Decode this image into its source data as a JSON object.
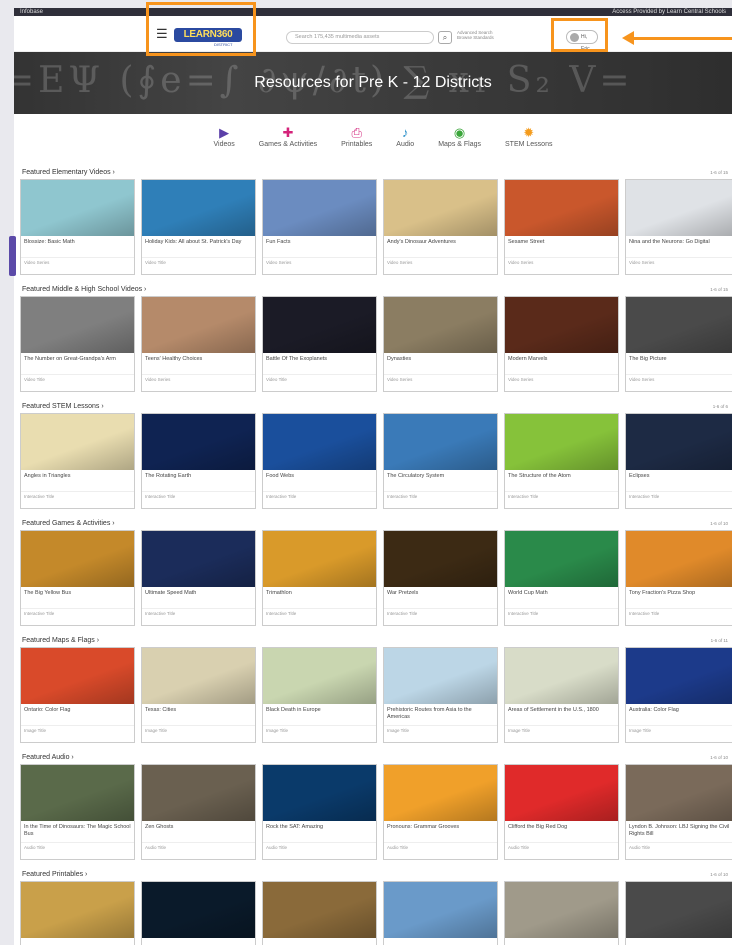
{
  "topbar": {
    "brand": "Infobase",
    "notice": "Access Provided by Learn Central Schools"
  },
  "header": {
    "logo_text": "LEARN360",
    "logo_sub": "DISTRICT",
    "search_placeholder": "Search 175,435 multimedia assets",
    "advanced_search": "Advanced Search",
    "browse_standards": "Browse Standards",
    "user_label": "Hi, Eric"
  },
  "hero": {
    "title": "Resources for Pre K - 12 Districts"
  },
  "categories": [
    {
      "label": "Videos",
      "icon": "play-icon",
      "color": "#5b3fa8"
    },
    {
      "label": "Games & Activities",
      "icon": "puzzle-icon",
      "color": "#d4237a"
    },
    {
      "label": "Printables",
      "icon": "printer-icon",
      "color": "#d63384"
    },
    {
      "label": "Audio",
      "icon": "speaker-icon",
      "color": "#2a8fc9"
    },
    {
      "label": "Maps & Flags",
      "icon": "globe-icon",
      "color": "#3aa63a"
    },
    {
      "label": "STEM Lessons",
      "icon": "gear-icon",
      "color": "#f49b1c"
    }
  ],
  "sections": [
    {
      "title": "Featured Elementary Videos ›",
      "count": "1-6 of 15",
      "cards": [
        {
          "title": "Blossize: Basic Math",
          "sub": "Video Series"
        },
        {
          "title": "Holiday Kids: All about St. Patrick's Day",
          "sub": "Video Title"
        },
        {
          "title": "Fun Facts",
          "sub": "Video Series"
        },
        {
          "title": "Andy's Dinosaur Adventures",
          "sub": "Video Series"
        },
        {
          "title": "Sesame Street",
          "sub": "Video Series"
        },
        {
          "title": "Nina and the Neurons: Go Digital",
          "sub": "Video Series"
        }
      ]
    },
    {
      "title": "Featured Middle & High School Videos ›",
      "count": "1-6 of 15",
      "cards": [
        {
          "title": "The Number on Great-Grandpa's Arm",
          "sub": "Video Title"
        },
        {
          "title": "Teens' Healthy Choices",
          "sub": "Video Series"
        },
        {
          "title": "Battle Of The Exoplanets",
          "sub": "Video Title"
        },
        {
          "title": "Dynasties",
          "sub": "Video Series"
        },
        {
          "title": "Modern Marvels",
          "sub": "Video Series"
        },
        {
          "title": "The Big Picture",
          "sub": "Video Series"
        }
      ]
    },
    {
      "title": "Featured STEM Lessons ›",
      "count": "1-6 of 6",
      "cards": [
        {
          "title": "Angles in Triangles",
          "sub": "Interactive Title"
        },
        {
          "title": "The Rotating Earth",
          "sub": "Interactive Title"
        },
        {
          "title": "Food Webs",
          "sub": "Interactive Title"
        },
        {
          "title": "The Circulatory System",
          "sub": "Interactive Title"
        },
        {
          "title": "The Structure of the Atom",
          "sub": "Interactive Title"
        },
        {
          "title": "Eclipses",
          "sub": "Interactive Title"
        }
      ]
    },
    {
      "title": "Featured Games & Activities ›",
      "count": "1-6 of 10",
      "cards": [
        {
          "title": "The Big Yellow Bus",
          "sub": "Interactive Title"
        },
        {
          "title": "Ultimate Speed Math",
          "sub": "Interactive Title"
        },
        {
          "title": "Trimathlon",
          "sub": "Interactive Title"
        },
        {
          "title": "War Pretzels",
          "sub": "Interactive Title"
        },
        {
          "title": "World Cup Math",
          "sub": "Interactive Title"
        },
        {
          "title": "Tony Fraction's Pizza Shop",
          "sub": "Interactive Title"
        }
      ]
    },
    {
      "title": "Featured Maps & Flags ›",
      "count": "1-6 of 11",
      "cards": [
        {
          "title": "Ontario: Color Flag",
          "sub": "Image Title"
        },
        {
          "title": "Texas: Cities",
          "sub": "Image Title"
        },
        {
          "title": "Black Death in Europe",
          "sub": "Image Title"
        },
        {
          "title": "Prehistoric Routes from Asia to the Americas",
          "sub": "Image Title"
        },
        {
          "title": "Areas of Settlement in the U.S., 1800",
          "sub": "Image Title"
        },
        {
          "title": "Australia: Color Flag",
          "sub": "Image Title"
        }
      ]
    },
    {
      "title": "Featured Audio ›",
      "count": "1-6 of 10",
      "cards": [
        {
          "title": "In the Time of Dinosaurs: The Magic School Bus",
          "sub": "Audio Title"
        },
        {
          "title": "Zen Ghosts",
          "sub": "Audio Title"
        },
        {
          "title": "Rock the SAT: Amazing",
          "sub": "Audio Title"
        },
        {
          "title": "Pronouns: Grammar Grooves",
          "sub": "Audio Title"
        },
        {
          "title": "Clifford the Big Red Dog",
          "sub": "Audio Title"
        },
        {
          "title": "Lyndon B. Johnson: LBJ Signing the Civil Rights Bill",
          "sub": "Audio Title"
        }
      ]
    },
    {
      "title": "Featured Printables ›",
      "count": "1-6 of 10",
      "cards": [
        {
          "title": "",
          "sub": ""
        },
        {
          "title": "",
          "sub": ""
        },
        {
          "title": "",
          "sub": ""
        },
        {
          "title": "",
          "sub": ""
        },
        {
          "title": "",
          "sub": ""
        },
        {
          "title": "",
          "sub": ""
        }
      ]
    }
  ],
  "thumb_colors": [
    [
      "#8fc6cf",
      "#2f7fb8",
      "#6b8cc0",
      "#d9c089",
      "#c9572c",
      "#dfe2e6"
    ],
    [
      "#7f7f7f",
      "#b58a6a",
      "#1b1b26",
      "#8b7d62",
      "#5a2a1a",
      "#4a4a4a"
    ],
    [
      "#e9ddb0",
      "#0f2352",
      "#1a4f9c",
      "#3a7ab8",
      "#86c23a",
      "#1d2a44"
    ],
    [
      "#c4892a",
      "#1b2c5a",
      "#d99a2a",
      "#3c2a14",
      "#2a8a4a",
      "#e08a2a"
    ],
    [
      "#d94a2a",
      "#d9d0b0",
      "#c9d6b0",
      "#bcd6e6",
      "#d8dcc8",
      "#1c3a8a"
    ],
    [
      "#5a6a4a",
      "#6a6050",
      "#0a3a6a",
      "#f0a02a",
      "#e02a2a",
      "#7a6a5a"
    ],
    [
      "#c9a04a",
      "#0a1a2a",
      "#8a6a3a",
      "#6a9ac9",
      "#a09a8a",
      "#4a4a4a"
    ]
  ]
}
